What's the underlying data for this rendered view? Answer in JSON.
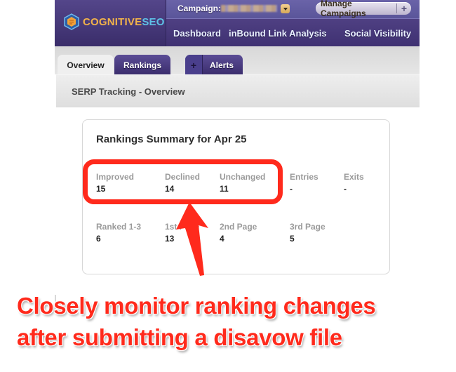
{
  "brand": {
    "logo_part1": "COGNITIVE",
    "logo_part2": "SEO"
  },
  "topbar": {
    "campaign_label": "Campaign:",
    "campaign_value": "(blurred)",
    "manage_label": "Manage Campaigns",
    "manage_plus": "+"
  },
  "nav": {
    "items": [
      "Dashboard",
      "inBound Link Analysis",
      "Social Visibility"
    ]
  },
  "tabs": {
    "overview": "Overview",
    "rankings": "Rankings",
    "alerts_plus": "+",
    "alerts": "Alerts"
  },
  "section": {
    "title": "SERP Tracking - Overview"
  },
  "summary": {
    "title": "Rankings Summary for Apr 25",
    "row1": [
      {
        "label": "Improved",
        "value": "15"
      },
      {
        "label": "Declined",
        "value": "14"
      },
      {
        "label": "Unchanged",
        "value": "11"
      },
      {
        "label": "Entries",
        "value": "-"
      },
      {
        "label": "Exits",
        "value": "-"
      }
    ],
    "row2": [
      {
        "label": "Ranked 1-3",
        "value": "6"
      },
      {
        "label": "1st Page",
        "value": "13"
      },
      {
        "label": "2nd Page",
        "value": "4"
      },
      {
        "label": "3rd Page",
        "value": "5"
      }
    ]
  },
  "annotation": {
    "line1": "Closely monitor ranking changes",
    "line2": "after submitting a disavow file",
    "color": "#ff2a1c"
  },
  "colors": {
    "header": "#4a3d80",
    "logo_orange": "#f1b24a",
    "logo_blue": "#5ec1e6"
  }
}
